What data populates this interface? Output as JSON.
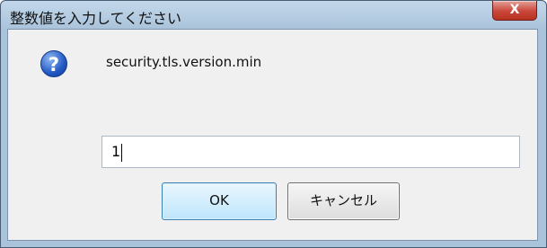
{
  "window": {
    "title": "整数値を入力してください",
    "close_glyph": "X"
  },
  "dialog": {
    "icon": "question-icon",
    "icon_glyph": "?",
    "message": "security.tls.version.min",
    "input_value": "1",
    "ok_label": "OK",
    "cancel_label": "キャンセル"
  },
  "colors": {
    "titlebar": "#a9c3da",
    "close_button": "#c9463a",
    "icon_blue": "#2258c4",
    "client_bg": "#f0f0f0"
  }
}
